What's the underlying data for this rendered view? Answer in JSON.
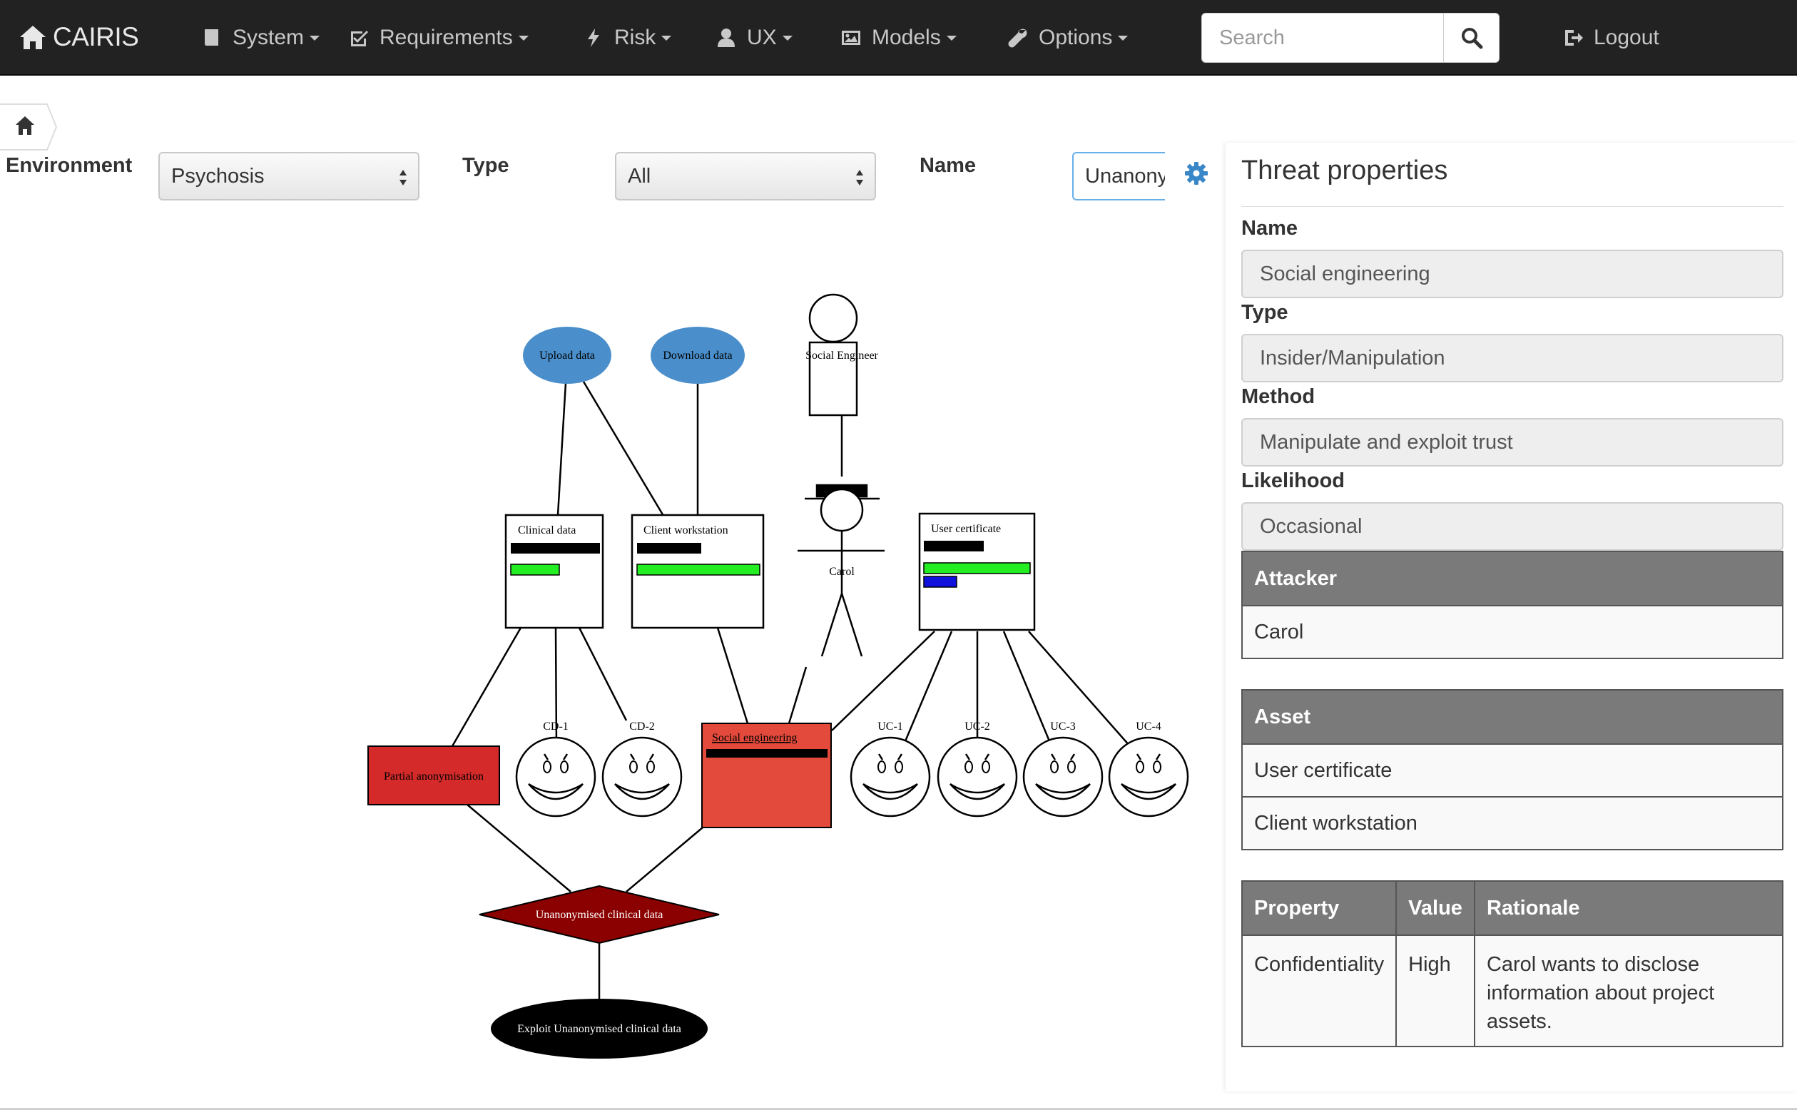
{
  "navbar": {
    "brand": "CAIRIS",
    "menus": [
      {
        "label": "System",
        "icon": "book-icon"
      },
      {
        "label": "Requirements",
        "icon": "check-square-icon"
      },
      {
        "label": "Risk",
        "icon": "bolt-icon"
      },
      {
        "label": "UX",
        "icon": "user-icon"
      },
      {
        "label": "Models",
        "icon": "picture-icon"
      },
      {
        "label": "Options",
        "icon": "wrench-icon"
      }
    ],
    "search_placeholder": "Search",
    "logout_label": "Logout"
  },
  "filters": {
    "environment_label": "Environment",
    "environment_value": "Psychosis",
    "type_label": "Type",
    "type_value": "All",
    "name_label": "Name",
    "name_value": "Unanonymised clinical data"
  },
  "diagram": {
    "use_cases": [
      "Upload data",
      "Download data"
    ],
    "roles": [
      "Social Engineer"
    ],
    "attacker": "Carol",
    "assets": [
      "Clinical data",
      "Client workstation",
      "User certificate"
    ],
    "vulnerability": "Partial anonymisation",
    "threat": "Social engineering",
    "personas": [
      "CD-1",
      "CD-2",
      "UC-1",
      "UC-2",
      "UC-3",
      "UC-4"
    ],
    "obstacle": "Unanonymised clinical data",
    "goal": "Exploit Unanonymised clinical data",
    "colors": {
      "use_case": "#4a8fcb",
      "vulnerability": "#d42a2a",
      "threat": "#e34a3c",
      "obstacle": "#8b0000",
      "security_green": "#22ee22",
      "security_blue": "#1111dd"
    }
  },
  "panel": {
    "title": "Threat properties",
    "name_label": "Name",
    "name_value": "Social engineering",
    "type_label": "Type",
    "type_value": "Insider/Manipulation",
    "method_label": "Method",
    "method_value": "Manipulate and exploit trust",
    "likelihood_label": "Likelihood",
    "likelihood_value": "Occasional",
    "attacker_header": "Attacker",
    "attackers": [
      "Carol"
    ],
    "asset_header": "Asset",
    "assets": [
      "User certificate",
      "Client workstation"
    ],
    "property_headers": {
      "property": "Property",
      "value": "Value",
      "rationale": "Rationale"
    },
    "properties": [
      {
        "property": "Confidentiality",
        "value": "High",
        "rationale": "Carol wants to disclose information about project assets."
      }
    ]
  }
}
